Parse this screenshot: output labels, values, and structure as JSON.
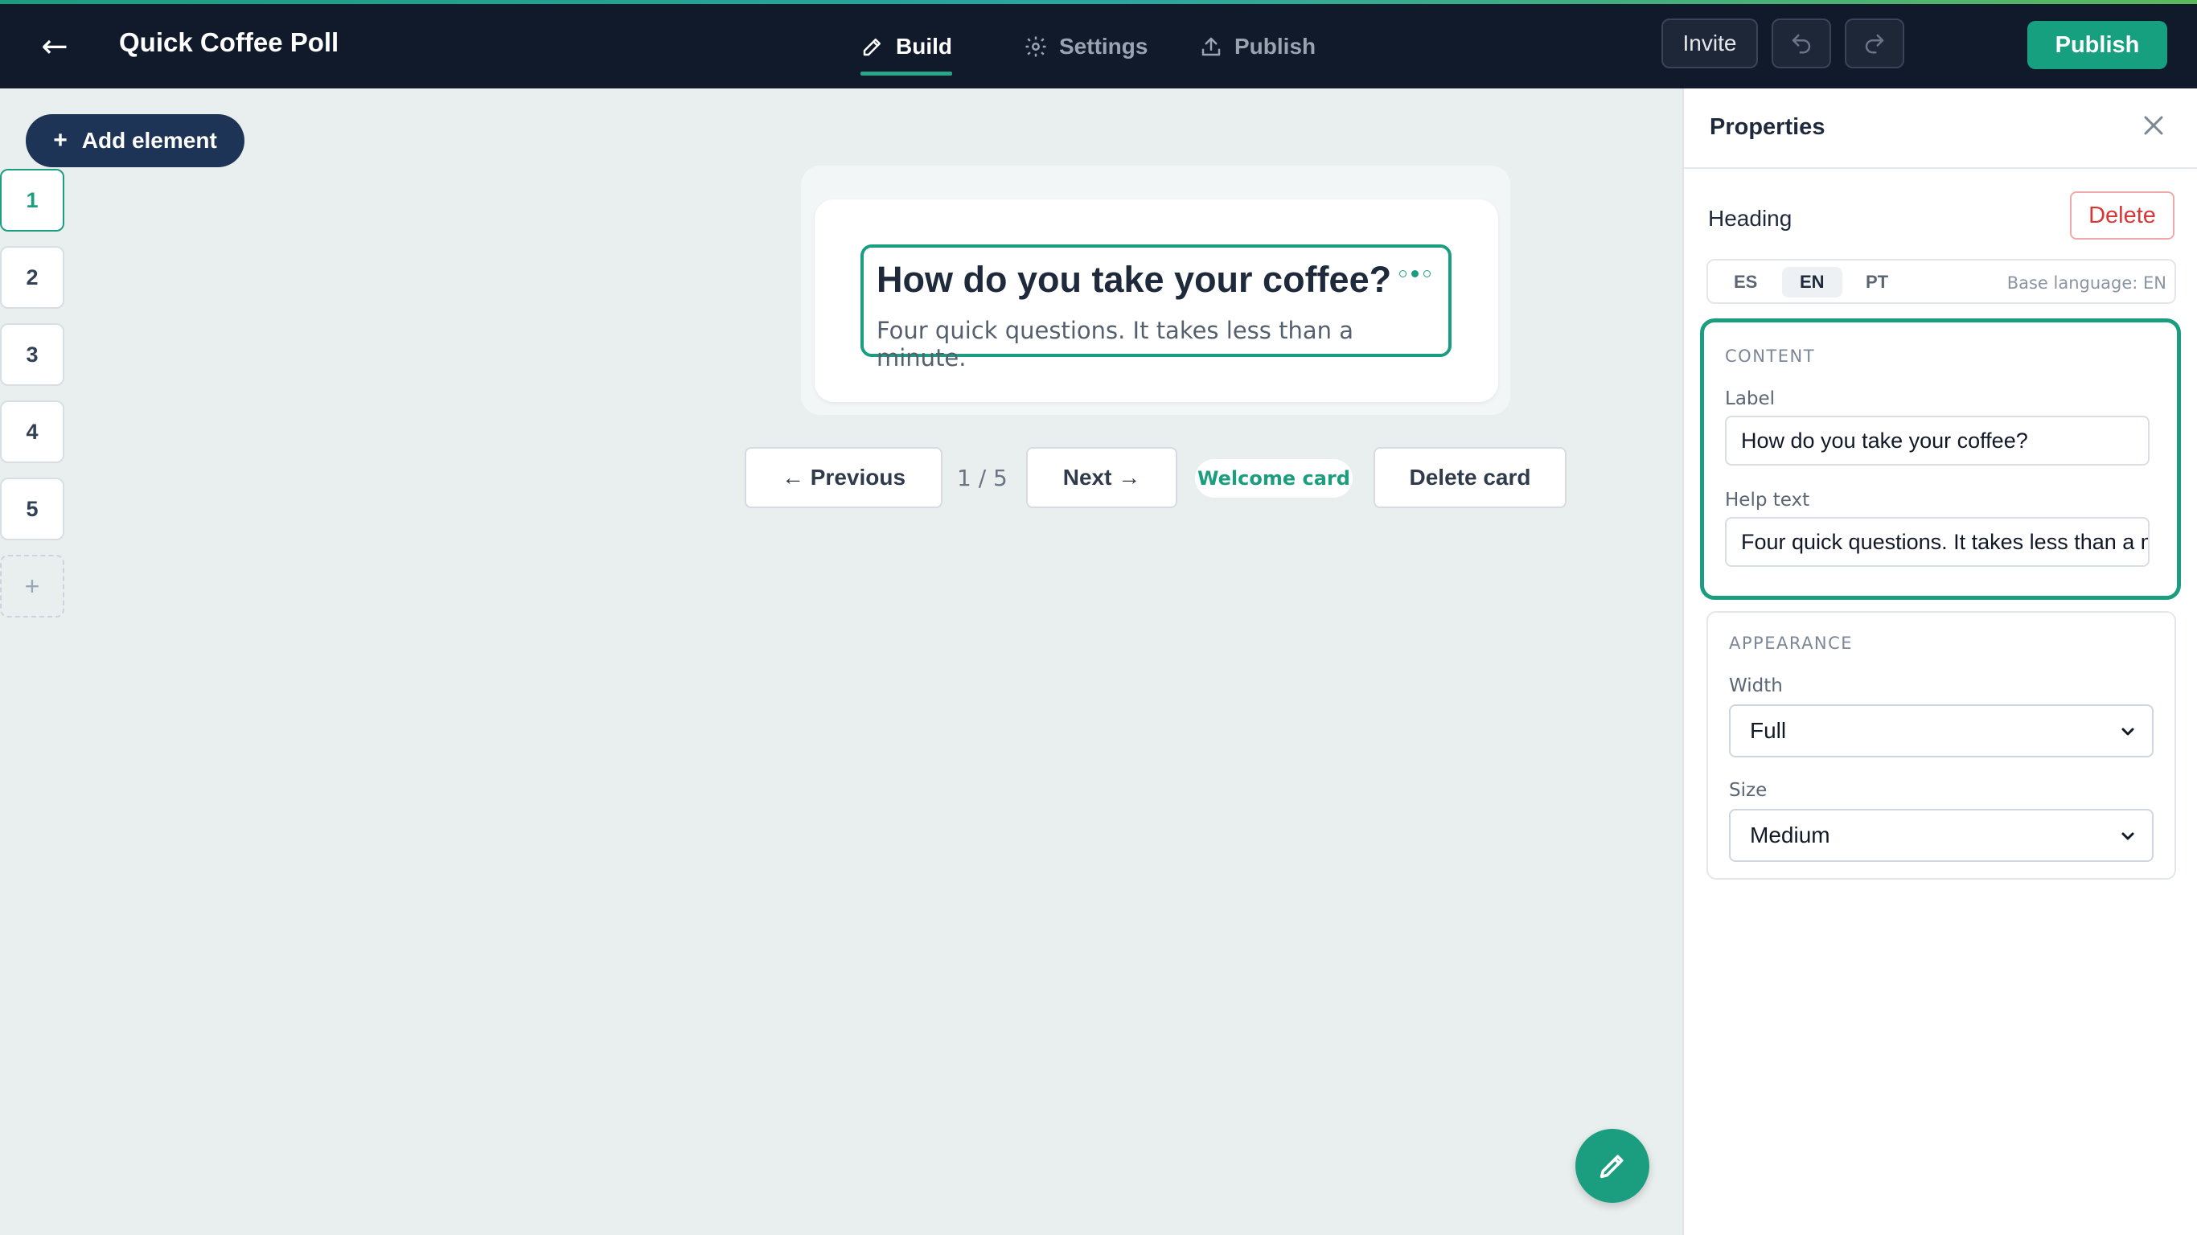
{
  "topbar": {
    "title": "Quick Coffee Poll",
    "tabs": [
      {
        "label": "Build",
        "icon": "pencil-icon",
        "active": true
      },
      {
        "label": "Settings",
        "icon": "gear-icon",
        "active": false
      },
      {
        "label": "Publish",
        "icon": "upload-icon",
        "active": false
      }
    ],
    "invite_label": "Invite",
    "publish_label": "Publish"
  },
  "left_rail": {
    "add_element_label": "Add element",
    "pages": [
      "1",
      "2",
      "3",
      "4",
      "5"
    ],
    "active_page": "1",
    "add_page_label": "+"
  },
  "canvas": {
    "heading": "How do you take your coffee?",
    "help_text": "Four quick questions. It takes less than a minute.",
    "previous_label": "← Previous",
    "pager": "1 / 5",
    "next_label": "Next →",
    "badge": "Welcome card",
    "delete_card_label": "Delete card"
  },
  "properties": {
    "title": "Properties",
    "element_type": "Heading",
    "delete_label": "Delete",
    "languages": [
      "ES",
      "EN",
      "PT"
    ],
    "active_language": "EN",
    "base_language": "Base language: EN",
    "content": {
      "section_title": "CONTENT",
      "label_label": "Label",
      "label_value": "How do you take your coffee?",
      "help_label": "Help text",
      "help_value": "Four quick questions. It takes less than a minute."
    },
    "appearance": {
      "section_title": "APPEARANCE",
      "width_label": "Width",
      "width_value": "Full",
      "size_label": "Size",
      "size_value": "Medium"
    }
  },
  "colors": {
    "accent": "#1b9e7f",
    "topbar": "#111a2b",
    "add_element": "#1e3456",
    "danger": "#d93636"
  }
}
